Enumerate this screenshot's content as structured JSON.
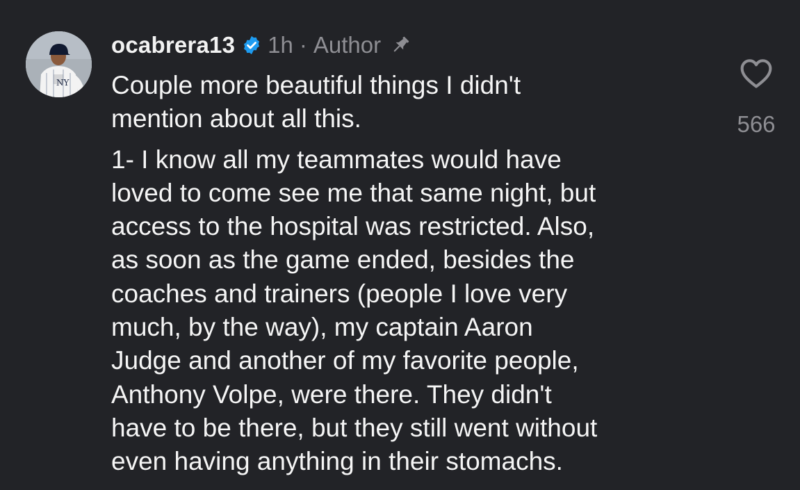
{
  "comment": {
    "username": "ocabrera13",
    "time": "1h",
    "separator": "·",
    "badge": "Author",
    "avatar_icon": "player-avatar",
    "verified_icon": "verified-badge-icon",
    "pin_icon": "pin-icon",
    "paragraphs": [
      "Couple more beautiful things I didn't\nmention about all this.",
      "1- I know all my teammates would have\nloved to come see me that same night, but\naccess to the hospital was restricted. Also,\nas soon as the game ended, besides the\ncoaches and trainers (people I love very\nmuch, by the way), my captain Aaron\nJudge and another of my favorite people,\nAnthony Volpe, were there. They didn't\nhave to be there, but they still went without\neven having anything in their stomachs."
    ],
    "like_icon": "heart-icon",
    "like_count": "566"
  },
  "colors": {
    "background": "#222327",
    "text": "#f5f5f5",
    "muted": "#8e8e93",
    "verified": "#1d9bf0"
  }
}
